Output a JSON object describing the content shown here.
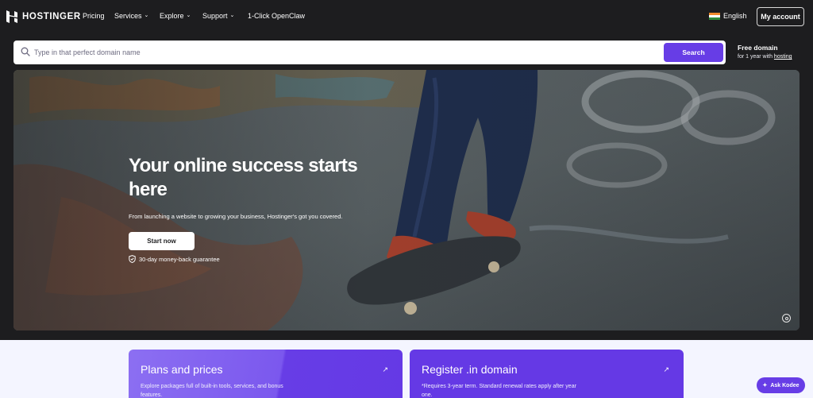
{
  "brand": {
    "name": "HOSTINGER"
  },
  "nav": {
    "items": [
      {
        "label": "Pricing",
        "dropdown": false
      },
      {
        "label": "Services",
        "dropdown": true
      },
      {
        "label": "Explore",
        "dropdown": true
      },
      {
        "label": "Support",
        "dropdown": true
      },
      {
        "label": "1-Click OpenClaw",
        "dropdown": false
      }
    ],
    "language": "English",
    "account_button": "My account"
  },
  "search": {
    "placeholder": "Type in that perfect domain name",
    "value": "",
    "button": "Search",
    "promo_title": "Free domain",
    "promo_text": "for 1 year with ",
    "promo_link": "hosting"
  },
  "hero": {
    "title": "Your online success starts here",
    "subtitle": "From launching a website to growing your business, Hostinger's got you covered.",
    "cta": "Start now",
    "guarantee": "30-day money-back guarantee"
  },
  "cards": [
    {
      "title": "Plans and prices",
      "text": "Explore packages full of built-in tools, services, and bonus features."
    },
    {
      "title": "Register .in domain",
      "text": "*Requires 3-year term. Standard renewal rates apply after year one."
    }
  ],
  "assistant": {
    "label": "Ask Kodee"
  },
  "colors": {
    "accent": "#673de6",
    "header_bg": "#1d1d1f",
    "section_bg": "#f4f5ff"
  },
  "icons": [
    "hostinger-logo-icon",
    "chevron-down-icon",
    "india-flag-icon",
    "search-icon",
    "shield-check-icon",
    "arrow-up-right-icon",
    "video-control-icon",
    "sparkle-icon"
  ]
}
